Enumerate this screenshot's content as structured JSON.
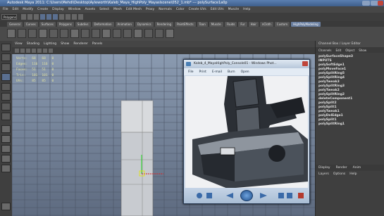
{
  "window": {
    "title": "Autodesk Maya 2011: C:\\Users\\Mehdi\\Desktop\\Ayleworth\\Kaleb_Maya_HighPoly_Mayaslscene\\052_1.mb* --- polySurface1a0p"
  },
  "menubar": {
    "items": [
      "File",
      "Edit",
      "Modify",
      "Create",
      "Display",
      "Window",
      "Assets",
      "Select",
      "Mesh",
      "Edit Mesh",
      "Proxy",
      "Normals",
      "Color",
      "Create UVs",
      "Edit UVs",
      "Muscle",
      "Help"
    ]
  },
  "statusline": {
    "mode": "Polygons"
  },
  "shelf": {
    "tabs": [
      "General",
      "Curves",
      "Surfaces",
      "Polygons",
      "Subdivs",
      "Deformation",
      "Animation",
      "Dynamics",
      "Rendering",
      "PaintEffects",
      "Toon",
      "Muscle",
      "Fluids",
      "Fur",
      "Hair",
      "nCloth",
      "Custom",
      "HighPolyModeling"
    ],
    "active": "HighPolyModeling"
  },
  "viewport": {
    "menu": [
      "View",
      "Shading",
      "Lighting",
      "Show",
      "Renderer",
      "Panels"
    ],
    "hud": {
      "rows": [
        {
          "label": "Verts:",
          "a": "68",
          "b": "68",
          "c": "0"
        },
        {
          "label": "Edges:",
          "a": "116",
          "b": "116",
          "c": "0"
        },
        {
          "label": "Faces:",
          "a": "51",
          "b": "51",
          "c": "0"
        },
        {
          "label": "Tris:",
          "a": "101",
          "b": "101",
          "c": "0"
        },
        {
          "label": "UVs:",
          "a": "85",
          "b": "85",
          "c": "0"
        }
      ]
    }
  },
  "photo_viewer": {
    "title": "Kaleb_4_MayaHighPoly_Console01 - Windows Phot...",
    "menu": [
      "File",
      "Print",
      "E-mail",
      "Burn",
      "Open"
    ]
  },
  "right_panel": {
    "header": "Channel Box / Layer Editor",
    "tabs": [
      "Channels",
      "Edit",
      "Object",
      "Show"
    ],
    "title": "polySurfaceShape3",
    "inputs_label": "INPUTS",
    "inputs": [
      "polySoftEdge1",
      "polyMoveFace1",
      "polySplitRing5",
      "polySplitRing4",
      "polyTweak3",
      "polySplitRing3",
      "polyTweak2",
      "polySplitRing2",
      "deleteComponent1",
      "polySplit2",
      "polySplit1",
      "polyTweak1",
      "polyDelEdge1",
      "polySplit1",
      "polySplitRing1"
    ],
    "bottom_tabs": [
      "Display",
      "Render",
      "Anim"
    ],
    "layer_menu": [
      "Layers",
      "Options",
      "Help"
    ]
  },
  "colors": {
    "accent": "#6a7fa0",
    "title_bar": "#4c6e9e",
    "viewport_top": "#8a9ab0"
  }
}
